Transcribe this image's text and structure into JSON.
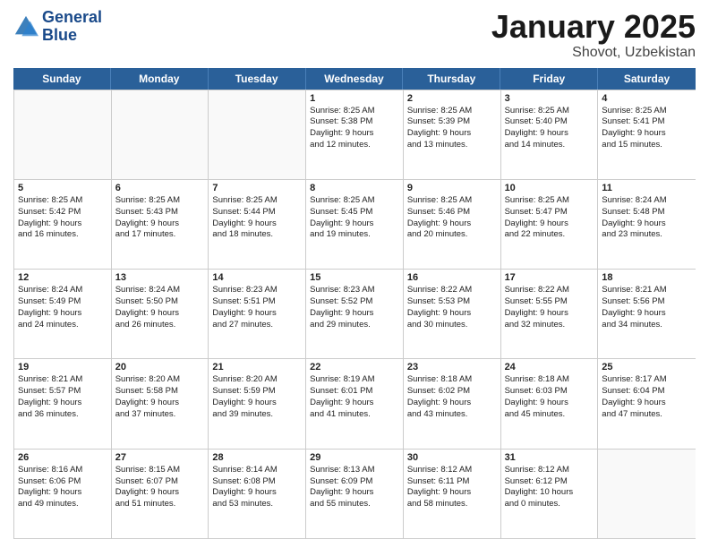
{
  "header": {
    "logo_line1": "General",
    "logo_line2": "Blue",
    "month": "January 2025",
    "location": "Shovot, Uzbekistan"
  },
  "weekdays": [
    "Sunday",
    "Monday",
    "Tuesday",
    "Wednesday",
    "Thursday",
    "Friday",
    "Saturday"
  ],
  "rows": [
    [
      {
        "day": "",
        "lines": []
      },
      {
        "day": "",
        "lines": []
      },
      {
        "day": "",
        "lines": []
      },
      {
        "day": "1",
        "lines": [
          "Sunrise: 8:25 AM",
          "Sunset: 5:38 PM",
          "Daylight: 9 hours",
          "and 12 minutes."
        ]
      },
      {
        "day": "2",
        "lines": [
          "Sunrise: 8:25 AM",
          "Sunset: 5:39 PM",
          "Daylight: 9 hours",
          "and 13 minutes."
        ]
      },
      {
        "day": "3",
        "lines": [
          "Sunrise: 8:25 AM",
          "Sunset: 5:40 PM",
          "Daylight: 9 hours",
          "and 14 minutes."
        ]
      },
      {
        "day": "4",
        "lines": [
          "Sunrise: 8:25 AM",
          "Sunset: 5:41 PM",
          "Daylight: 9 hours",
          "and 15 minutes."
        ]
      }
    ],
    [
      {
        "day": "5",
        "lines": [
          "Sunrise: 8:25 AM",
          "Sunset: 5:42 PM",
          "Daylight: 9 hours",
          "and 16 minutes."
        ]
      },
      {
        "day": "6",
        "lines": [
          "Sunrise: 8:25 AM",
          "Sunset: 5:43 PM",
          "Daylight: 9 hours",
          "and 17 minutes."
        ]
      },
      {
        "day": "7",
        "lines": [
          "Sunrise: 8:25 AM",
          "Sunset: 5:44 PM",
          "Daylight: 9 hours",
          "and 18 minutes."
        ]
      },
      {
        "day": "8",
        "lines": [
          "Sunrise: 8:25 AM",
          "Sunset: 5:45 PM",
          "Daylight: 9 hours",
          "and 19 minutes."
        ]
      },
      {
        "day": "9",
        "lines": [
          "Sunrise: 8:25 AM",
          "Sunset: 5:46 PM",
          "Daylight: 9 hours",
          "and 20 minutes."
        ]
      },
      {
        "day": "10",
        "lines": [
          "Sunrise: 8:25 AM",
          "Sunset: 5:47 PM",
          "Daylight: 9 hours",
          "and 22 minutes."
        ]
      },
      {
        "day": "11",
        "lines": [
          "Sunrise: 8:24 AM",
          "Sunset: 5:48 PM",
          "Daylight: 9 hours",
          "and 23 minutes."
        ]
      }
    ],
    [
      {
        "day": "12",
        "lines": [
          "Sunrise: 8:24 AM",
          "Sunset: 5:49 PM",
          "Daylight: 9 hours",
          "and 24 minutes."
        ]
      },
      {
        "day": "13",
        "lines": [
          "Sunrise: 8:24 AM",
          "Sunset: 5:50 PM",
          "Daylight: 9 hours",
          "and 26 minutes."
        ]
      },
      {
        "day": "14",
        "lines": [
          "Sunrise: 8:23 AM",
          "Sunset: 5:51 PM",
          "Daylight: 9 hours",
          "and 27 minutes."
        ]
      },
      {
        "day": "15",
        "lines": [
          "Sunrise: 8:23 AM",
          "Sunset: 5:52 PM",
          "Daylight: 9 hours",
          "and 29 minutes."
        ]
      },
      {
        "day": "16",
        "lines": [
          "Sunrise: 8:22 AM",
          "Sunset: 5:53 PM",
          "Daylight: 9 hours",
          "and 30 minutes."
        ]
      },
      {
        "day": "17",
        "lines": [
          "Sunrise: 8:22 AM",
          "Sunset: 5:55 PM",
          "Daylight: 9 hours",
          "and 32 minutes."
        ]
      },
      {
        "day": "18",
        "lines": [
          "Sunrise: 8:21 AM",
          "Sunset: 5:56 PM",
          "Daylight: 9 hours",
          "and 34 minutes."
        ]
      }
    ],
    [
      {
        "day": "19",
        "lines": [
          "Sunrise: 8:21 AM",
          "Sunset: 5:57 PM",
          "Daylight: 9 hours",
          "and 36 minutes."
        ]
      },
      {
        "day": "20",
        "lines": [
          "Sunrise: 8:20 AM",
          "Sunset: 5:58 PM",
          "Daylight: 9 hours",
          "and 37 minutes."
        ]
      },
      {
        "day": "21",
        "lines": [
          "Sunrise: 8:20 AM",
          "Sunset: 5:59 PM",
          "Daylight: 9 hours",
          "and 39 minutes."
        ]
      },
      {
        "day": "22",
        "lines": [
          "Sunrise: 8:19 AM",
          "Sunset: 6:01 PM",
          "Daylight: 9 hours",
          "and 41 minutes."
        ]
      },
      {
        "day": "23",
        "lines": [
          "Sunrise: 8:18 AM",
          "Sunset: 6:02 PM",
          "Daylight: 9 hours",
          "and 43 minutes."
        ]
      },
      {
        "day": "24",
        "lines": [
          "Sunrise: 8:18 AM",
          "Sunset: 6:03 PM",
          "Daylight: 9 hours",
          "and 45 minutes."
        ]
      },
      {
        "day": "25",
        "lines": [
          "Sunrise: 8:17 AM",
          "Sunset: 6:04 PM",
          "Daylight: 9 hours",
          "and 47 minutes."
        ]
      }
    ],
    [
      {
        "day": "26",
        "lines": [
          "Sunrise: 8:16 AM",
          "Sunset: 6:06 PM",
          "Daylight: 9 hours",
          "and 49 minutes."
        ]
      },
      {
        "day": "27",
        "lines": [
          "Sunrise: 8:15 AM",
          "Sunset: 6:07 PM",
          "Daylight: 9 hours",
          "and 51 minutes."
        ]
      },
      {
        "day": "28",
        "lines": [
          "Sunrise: 8:14 AM",
          "Sunset: 6:08 PM",
          "Daylight: 9 hours",
          "and 53 minutes."
        ]
      },
      {
        "day": "29",
        "lines": [
          "Sunrise: 8:13 AM",
          "Sunset: 6:09 PM",
          "Daylight: 9 hours",
          "and 55 minutes."
        ]
      },
      {
        "day": "30",
        "lines": [
          "Sunrise: 8:12 AM",
          "Sunset: 6:11 PM",
          "Daylight: 9 hours",
          "and 58 minutes."
        ]
      },
      {
        "day": "31",
        "lines": [
          "Sunrise: 8:12 AM",
          "Sunset: 6:12 PM",
          "Daylight: 10 hours",
          "and 0 minutes."
        ]
      },
      {
        "day": "",
        "lines": []
      }
    ]
  ]
}
